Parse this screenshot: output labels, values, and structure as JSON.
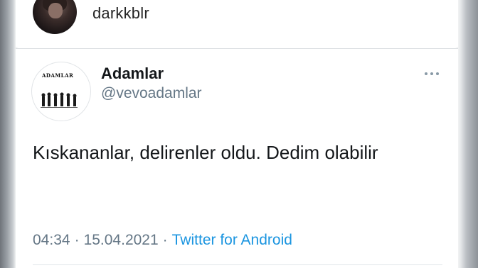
{
  "post": {
    "username": "darkkblr"
  },
  "tweet": {
    "display_name": "Adamlar",
    "handle": "@vevoadamlar",
    "avatar_logo_text": "ADAMLAR",
    "text": "Kıskananlar, delirenler oldu. Dedim olabilir",
    "time": "04:34",
    "separator": "·",
    "date": "15.04.2021",
    "source": "Twitter for Android"
  },
  "colors": {
    "text_primary": "#14171a",
    "text_secondary": "#657786",
    "link": "#1b95e0"
  },
  "icons": {
    "more": "more-horizontal-icon"
  }
}
